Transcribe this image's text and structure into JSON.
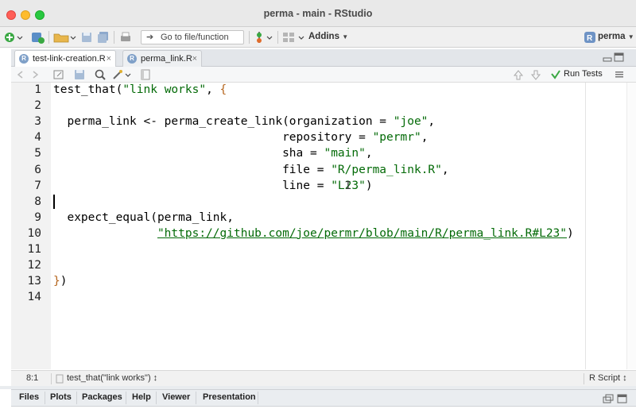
{
  "window": {
    "title": "perma - main - RStudio"
  },
  "toolbar": {
    "goto_placeholder": "Go to file/function",
    "addins_label": "Addins",
    "project_label": "perma"
  },
  "tabs": [
    {
      "label": "test-link-creation.R",
      "active": true
    },
    {
      "label": "perma_link.R",
      "active": false
    }
  ],
  "editor_toolbar": {
    "run_tests_label": "Run Tests"
  },
  "editor": {
    "line_numbers": [
      "1",
      "2",
      "3",
      "4",
      "5",
      "6",
      "7",
      "8",
      "9",
      "10",
      "11",
      "12",
      "13",
      "14"
    ],
    "lines": [
      "test_that(\"link works\", {",
      "",
      "  perma_link <- perma_create_link(organization = \"joe\",",
      "                                 repository = \"permr\",",
      "                                 sha = \"main\",",
      "                                 file = \"R/perma_link.R\",",
      "                                 line = \"L23\")",
      "",
      "  expect_equal(perma_link,",
      "               \"https://github.com/joe/permr/blob/main/R/perma_link.R#L23\")",
      "",
      "",
      "})",
      ""
    ]
  },
  "status": {
    "position": "8:1",
    "scope": "test_that(\"link works\") ↕",
    "file_type": "R Script ↕"
  },
  "bottom_tabs": [
    "Files",
    "Plots",
    "Packages",
    "Help",
    "Viewer",
    "Presentation"
  ],
  "colors": {
    "string": "#036a07",
    "brace": "#b5651d",
    "gutter": "#f2f2f2"
  }
}
